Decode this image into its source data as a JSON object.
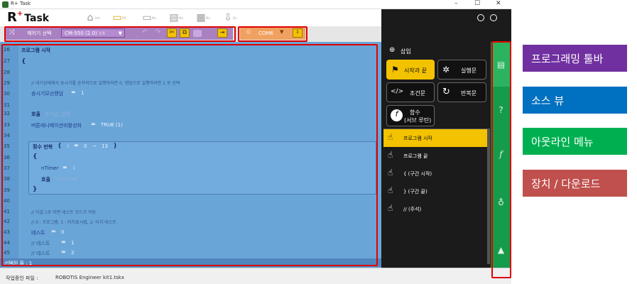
{
  "window": {
    "title": "R+ Task",
    "minimize": "–",
    "maximize": "☐",
    "close": "✕"
  },
  "logo": {
    "r": "R",
    "plus": "+",
    "task": "Task"
  },
  "nav": [
    {
      "icon": "home-icon",
      "glyph": "⌂",
      "label": "Hm"
    },
    {
      "icon": "monitor-active-icon",
      "glyph": "▭",
      "label": "PR"
    },
    {
      "icon": "monitor-icon",
      "glyph": "▭",
      "label": "Mo"
    },
    {
      "icon": "film-icon",
      "glyph": "▤",
      "label": "Mo"
    },
    {
      "icon": "clapper-icon",
      "glyph": "▦",
      "label": "Mo"
    },
    {
      "icon": "download-icon",
      "glyph": "⇩",
      "label": "Dn"
    }
  ],
  "toolbar": {
    "controller_label": "제어기 선택",
    "controller_value": "CM-550 (2.0)",
    "controller_suffix": "V4",
    "port_value": "COM6"
  },
  "lines": [
    "26",
    "27",
    "28",
    "29",
    "30",
    "31",
    "32",
    "33",
    "34",
    "35",
    "36",
    "37",
    "38",
    "39",
    "40",
    "41",
    "42",
    "43",
    "44",
    "45"
  ],
  "code": {
    "l26": "프로그램 시작",
    "l27": "{",
    "l29": "//    대기상태에서 숭시기를 순차적으로 실행하려면 0, 랜덤으로 실행하려면 1 로 선택",
    "l30_var": "숭시기모선랜덤",
    "l30_val": "1",
    "l32_kw": "호출",
    "l32_fn": "초기값_설정",
    "l33_var": "버튼에니메이션비활성화",
    "l33_val": "TRUE (1)",
    "l35_kw": "횟수 반복",
    "l35_paren_open": "(",
    "l35_i": "i",
    "l35_from": "0",
    "l35_tilde": "~",
    "l35_to": "13",
    "l35_paren_close": ")",
    "l36": "{",
    "l37_var": "nTimer",
    "l37_val": "i",
    "l38_kw": "호출",
    "l38_fn": "TimerSet",
    "l39": "}",
    "l41": "//    이걸 1로 하면 테스트 코드가 작동",
    "l42": "//    0 : 프로그램, 1 : 타치표시법, 2: 터치 테스트",
    "l43_var": "테스트",
    "l43_val": "0",
    "l44_var": "//    테스트",
    "l44_val": "1",
    "l45_var": "//    테스트",
    "l45_val": "2"
  },
  "status_line": "선택된 줄 : 1",
  "footer": {
    "label": "작업중인 파일 :",
    "value": "ROBOTIS Engineer kit1.tskx"
  },
  "panel": {
    "insert": "삽입",
    "btn_start_end": "시작과 끝",
    "btn_exec": "실행문",
    "btn_cond": "조건문",
    "btn_loop": "반복문",
    "btn_func_line1": "함수",
    "btn_func_line2": "(서브 루틴)",
    "items": [
      "프로그램 시작",
      "프로그램 끝",
      "{  (구간 시작)",
      "}  (구간 끝)",
      "//  (주석)"
    ]
  },
  "legend": [
    {
      "text": "프로그래밍 툴바",
      "color": "#7030a0"
    },
    {
      "text": "소스 뷰",
      "color": "#0070c0"
    },
    {
      "text": "아웃라인 메뉴",
      "color": "#00b050"
    },
    {
      "text": "장치 / 다운로드",
      "color": "#c0504d"
    }
  ]
}
